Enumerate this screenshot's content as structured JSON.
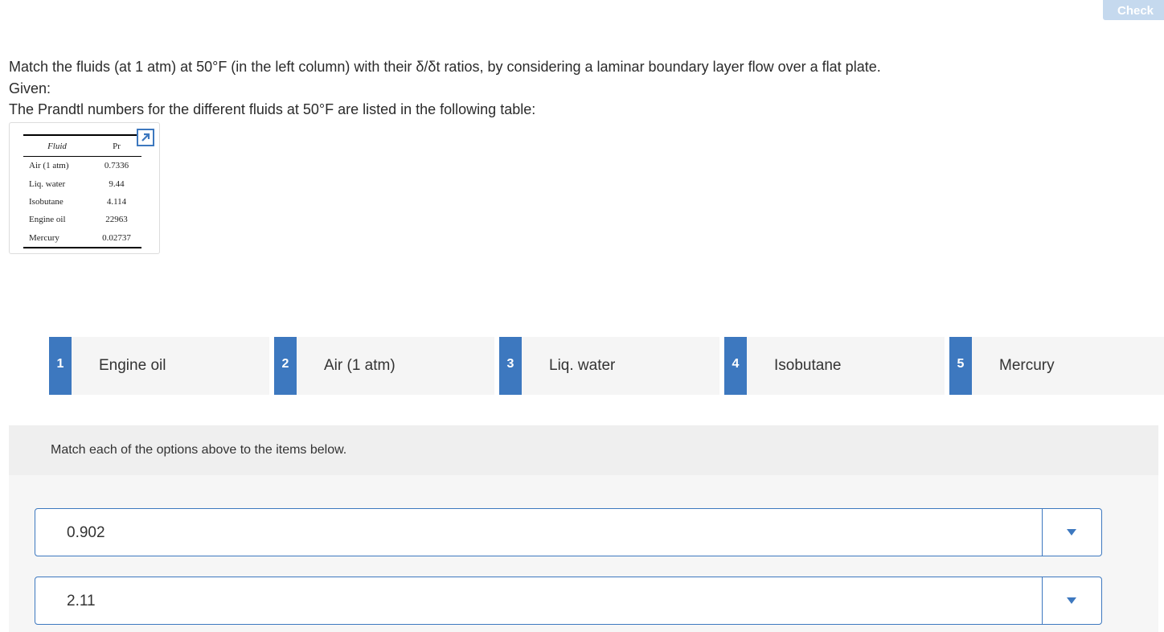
{
  "toolbar": {
    "check_label": "Check"
  },
  "question": {
    "line1": "Match the fluids (at 1 atm) at 50°F (in the left column) with their δ/δt ratios, by considering a laminar boundary layer flow over a flat plate.",
    "line2": "Given:",
    "line3": "The Prandtl numbers for the different fluids at 50°F are listed in the following table:"
  },
  "table": {
    "headers": [
      "Fluid",
      "Pr"
    ],
    "rows": [
      [
        "Air (1 atm)",
        "0.7336"
      ],
      [
        "Liq. water",
        "9.44"
      ],
      [
        "Isobutane",
        "4.114"
      ],
      [
        "Engine oil",
        "22963"
      ],
      [
        "Mercury",
        "0.02737"
      ]
    ]
  },
  "options": [
    {
      "num": "1",
      "label": "Engine oil"
    },
    {
      "num": "2",
      "label": "Air (1 atm)"
    },
    {
      "num": "3",
      "label": "Liq. water"
    },
    {
      "num": "4",
      "label": "Isobutane"
    },
    {
      "num": "5",
      "label": "Mercury"
    }
  ],
  "match": {
    "instruction": "Match each of the options above to the items below.",
    "items": [
      {
        "value": "0.902"
      },
      {
        "value": "2.11"
      }
    ]
  }
}
